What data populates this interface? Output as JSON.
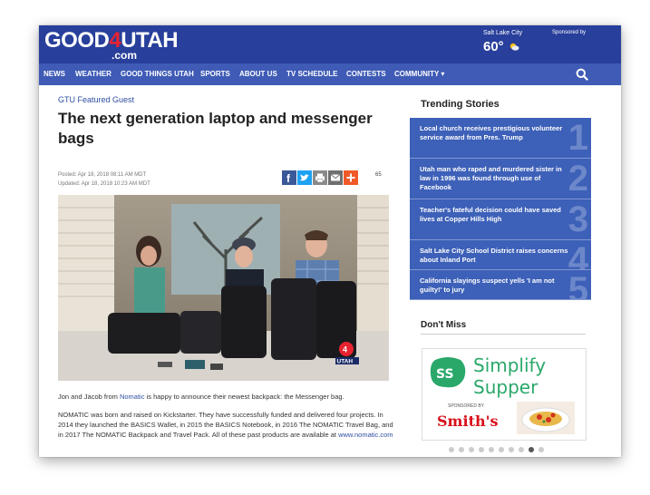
{
  "site": {
    "logo_main": "GOOD",
    "logo_four": "4",
    "logo_end": "UTAH",
    "logo_domain": ".com"
  },
  "weather": {
    "city": "Salt Lake City",
    "temp": "60°",
    "icon": "partly-sunny-icon",
    "sponsored": "Sponsored by"
  },
  "nav": {
    "items": [
      "NEWS",
      "WEATHER",
      "GOOD THINGS UTAH",
      "SPORTS",
      "ABOUT US",
      "TV SCHEDULE",
      "CONTESTS",
      "COMMUNITY ▾"
    ]
  },
  "article": {
    "category": "GTU Featured Guest",
    "headline": "The next generation laptop and messenger bags",
    "posted": "Posted: Apr 18, 2018 08:11 AM MDT",
    "updated": "Updated: Apr 18, 2018 10:23 AM MDT",
    "share_count": "65",
    "p1_pre": "Jon and Jacob from ",
    "p1_link": "Nomatic",
    "p1_post": " is happy to announce their newest backpack: the Messenger bag.",
    "p2_pre": "NOMATIC was born and raised on Kickstarter. They have successfully funded and delivered four projects. In 2014 they launched the BASICS Wallet, in 2015 the BASICS Notebook, in 2016 The NOMATIC Travel Bag, and in 2017 The NOMATIC Backpack and Travel Pack. All of these past products are available at ",
    "p2_link": "www.nomatic.com",
    "photo_bug": "UTAH"
  },
  "trending": {
    "title": "Trending Stories",
    "items": [
      {
        "num": "1",
        "text": "Local church receives prestigious volunteer service award from Pres. Trump"
      },
      {
        "num": "2",
        "text": "Utah man who raped and murdered sister in law in 1996 was found through use of Facebook"
      },
      {
        "num": "3",
        "text": "Teacher's fateful decision could have saved lives at Copper Hills High"
      },
      {
        "num": "4",
        "text": "Salt Lake City School District raises concerns about Inland Port"
      },
      {
        "num": "5",
        "text": "California slayings suspect yells 'I am not guilty!' to jury"
      }
    ]
  },
  "dont_miss": {
    "title": "Don't Miss",
    "ad_badge": "SS",
    "ad_line1": "Simplify",
    "ad_line2": "Supper",
    "ad_sponsor": "SPONSORED BY",
    "ad_brand": "Smith's"
  },
  "carousel": {
    "count": 10,
    "active": 8
  },
  "colors": {
    "header": "#283f9b",
    "nav": "#3f5bb6",
    "trending": "#3d60b8",
    "accent_red": "#e8232f",
    "ad_green": "#2aa86a"
  }
}
